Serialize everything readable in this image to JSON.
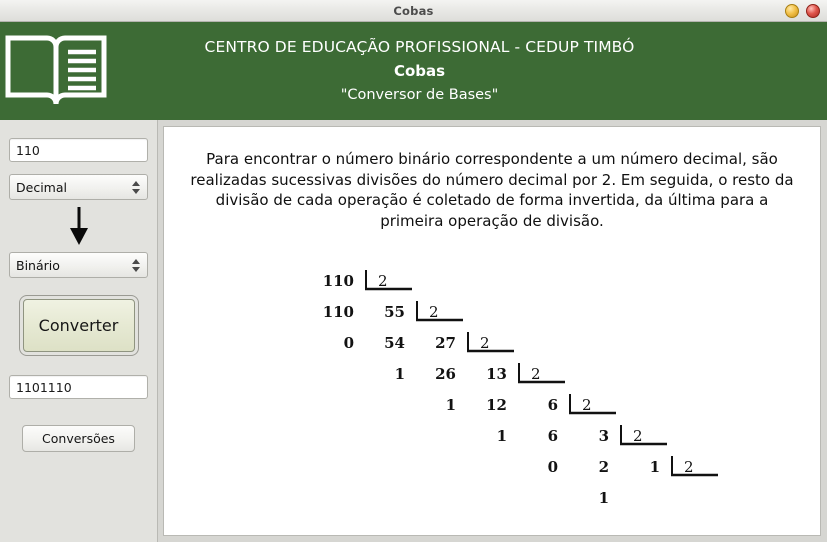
{
  "window": {
    "title": "Cobas",
    "buttons": [
      {
        "name": "minimize",
        "color": "#f2c14a"
      },
      {
        "name": "close",
        "color": "#e0564c"
      }
    ]
  },
  "header": {
    "bg_color": "#3d6b35",
    "logo_icon": "open-book-icon",
    "line1": "CENTRO DE EDUCAÇÃO PROFISSIONAL - CEDUP TIMBÓ",
    "line2": "Cobas",
    "line3": "\"Conversor de Bases\""
  },
  "sidebar": {
    "input_value": "110",
    "input_placeholder": "",
    "from_base": "Decimal",
    "arrow_icon": "down-arrow-icon",
    "to_base": "Binário",
    "convert_label": "Converter",
    "output_value": "1101110",
    "output_placeholder": "",
    "conversions_label": "Conversões"
  },
  "content": {
    "explanation": "Para encontrar o número binário correspondente a um número decimal, são realizadas sucessivas divisões do número decimal por 2. Em seguida, o resto da divisão de cada operação é coletado de forma invertida, da última para a primeira operação de divisão.",
    "diagram": {
      "divisor": "2",
      "steps": [
        {
          "dividend": "110",
          "product": "110",
          "remainder": "0",
          "quotient": "55"
        },
        {
          "dividend": "55",
          "product": "54",
          "remainder": "1",
          "quotient": "27"
        },
        {
          "dividend": "27",
          "product": "26",
          "remainder": "1",
          "quotient": "13"
        },
        {
          "dividend": "13",
          "product": "12",
          "remainder": "1",
          "quotient": "6"
        },
        {
          "dividend": "6",
          "product": "6",
          "remainder": "0",
          "quotient": "3"
        },
        {
          "dividend": "3",
          "product": "2",
          "remainder": "1",
          "quotient": "1"
        },
        {
          "dividend": "1",
          "product": "",
          "remainder": "",
          "quotient": "1"
        }
      ]
    }
  }
}
